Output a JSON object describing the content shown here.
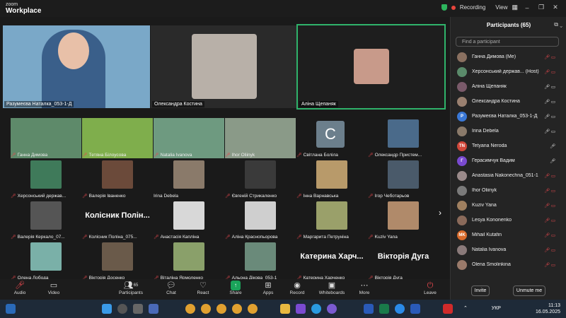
{
  "app": {
    "brand_top": "zoom",
    "brand_bottom": "Workplace"
  },
  "titlebar": {
    "recording": "Recording",
    "view": "View",
    "minimize": "–",
    "restore": "❐",
    "close": "✕"
  },
  "top_tiles": [
    {
      "name": "Разумеєва Наталка_053-1-Д",
      "bg": "#7aa8c8"
    },
    {
      "name": "Олександра Костина",
      "bg": "#2a2a2a"
    },
    {
      "name": "Аліна Щепаняк",
      "bg": "#1e1e1e"
    }
  ],
  "gallery": [
    {
      "name": "Ганна Димова",
      "kind": "video",
      "bg": "#5e8a6a"
    },
    {
      "name": "Тетяна Білоусова",
      "kind": "video",
      "bg": "#7fae4c"
    },
    {
      "name": "Natalia Ivanova",
      "kind": "video",
      "bg": "#6e9a80"
    },
    {
      "name": "Ihor Oliinyk",
      "kind": "video",
      "bg": "#8a9a88"
    },
    {
      "name": "Світлана Боліла",
      "kind": "avatar",
      "bg": "#6c7f8c",
      "initial": "C"
    },
    {
      "name": "Олександр Пристем...",
      "kind": "photo",
      "bg": "#4a6a8a"
    },
    {
      "name": "Херсонський держав...",
      "kind": "photo",
      "bg": "#3f7a5a"
    },
    {
      "name": "Валерія Іваненко",
      "kind": "photo",
      "bg": "#6b4a3a"
    },
    {
      "name": "Irina Debela",
      "kind": "photo",
      "bg": "#8a7a6a"
    },
    {
      "name": "Євгеній Стрикаленко",
      "kind": "photo",
      "bg": "#3a3a3a"
    },
    {
      "name": "Інна Варнавська",
      "kind": "photo",
      "bg": "#b89a6a"
    },
    {
      "name": "Ігор Чеботарьов",
      "kind": "photo",
      "bg": "#4a5a6a"
    },
    {
      "name": "Валерія Керкало_07...",
      "kind": "photo",
      "bg": "#555"
    },
    {
      "name": "Колісник Поліна_075...",
      "kind": "text",
      "big": "Колісник Полін..."
    },
    {
      "name": "Анастасія Капліна",
      "kind": "photo",
      "bg": "#d8d8d8"
    },
    {
      "name": "Аліна Краснопьорова",
      "kind": "photo",
      "bg": "#cfcfcf"
    },
    {
      "name": "Маргарита Петруніна",
      "kind": "photo",
      "bg": "#9aa06a"
    },
    {
      "name": "Kuziv Yana",
      "kind": "photo",
      "bg": "#b08a6a"
    },
    {
      "name": "Олена Лобода",
      "kind": "photo",
      "bg": "#7ab0a8"
    },
    {
      "name": "Вікторія Досенко",
      "kind": "photo",
      "bg": "#6a5a4a"
    },
    {
      "name": "Віталіна Ярмоленко",
      "kind": "photo",
      "bg": "#8aa06a"
    },
    {
      "name": "Альона Дікова_053-1",
      "kind": "photo",
      "bg": "#6a8a7a"
    },
    {
      "name": "Катерина Харченко",
      "kind": "text",
      "big": "Катерина Харч..."
    },
    {
      "name": "Вікторія Дуга",
      "kind": "text",
      "big": "Вікторія Дуга"
    }
  ],
  "toolbar": {
    "audio": "Audio",
    "video": "Video",
    "participants": "Participants",
    "participants_count": "65",
    "chat": "Chat",
    "react": "React",
    "share": "Share",
    "apps": "Apps",
    "record": "Record",
    "whiteboards": "Whiteboards",
    "more": "More",
    "leave": "Leave"
  },
  "panel": {
    "title": "Participants (65)",
    "search_placeholder": "Find a participant",
    "invite": "Invite",
    "unmute_me": "Unmute me",
    "participants": [
      {
        "name": "Ганна Димова (Me)",
        "bg": "#8a7060",
        "initial": ""
      },
      {
        "name": "Херсонський держав... (Host)",
        "bg": "#5a8a6a",
        "initial": ""
      },
      {
        "name": "Аліна Щепаняк",
        "bg": "#7a5a6a",
        "initial": ""
      },
      {
        "name": "Олександра Костина",
        "bg": "#9a8070",
        "initial": ""
      },
      {
        "name": "Разумеєва Наталка_053-1-Д",
        "bg": "#3a78d6",
        "initial": "Р"
      },
      {
        "name": "Irina Debela",
        "bg": "#8a7a6a",
        "initial": ""
      },
      {
        "name": "Tetyana Neroda",
        "bg": "#d0473a",
        "initial": "TN"
      },
      {
        "name": "Герасимчук Вадим",
        "bg": "#7a4ad0",
        "initial": "Г"
      },
      {
        "name": "Anastasia Nakonechna_051-1",
        "bg": "#9a8a8a",
        "initial": ""
      },
      {
        "name": "Ihor Oliinyk",
        "bg": "#7a7a7a",
        "initial": ""
      },
      {
        "name": "Kuziv Yana",
        "bg": "#a08060",
        "initial": ""
      },
      {
        "name": "Lesya Kononenko",
        "bg": "#8a6a5a",
        "initial": ""
      },
      {
        "name": "Mihail Kutafin",
        "bg": "#d86a2a",
        "initial": "MK"
      },
      {
        "name": "Natalia Ivanova",
        "bg": "#8a7a7a",
        "initial": ""
      },
      {
        "name": "Olena Smolinkina",
        "bg": "#9a7a6a",
        "initial": ""
      }
    ]
  },
  "taskbar": {
    "lang": "УКР",
    "time": "11:13",
    "date": "16.05.2025"
  }
}
